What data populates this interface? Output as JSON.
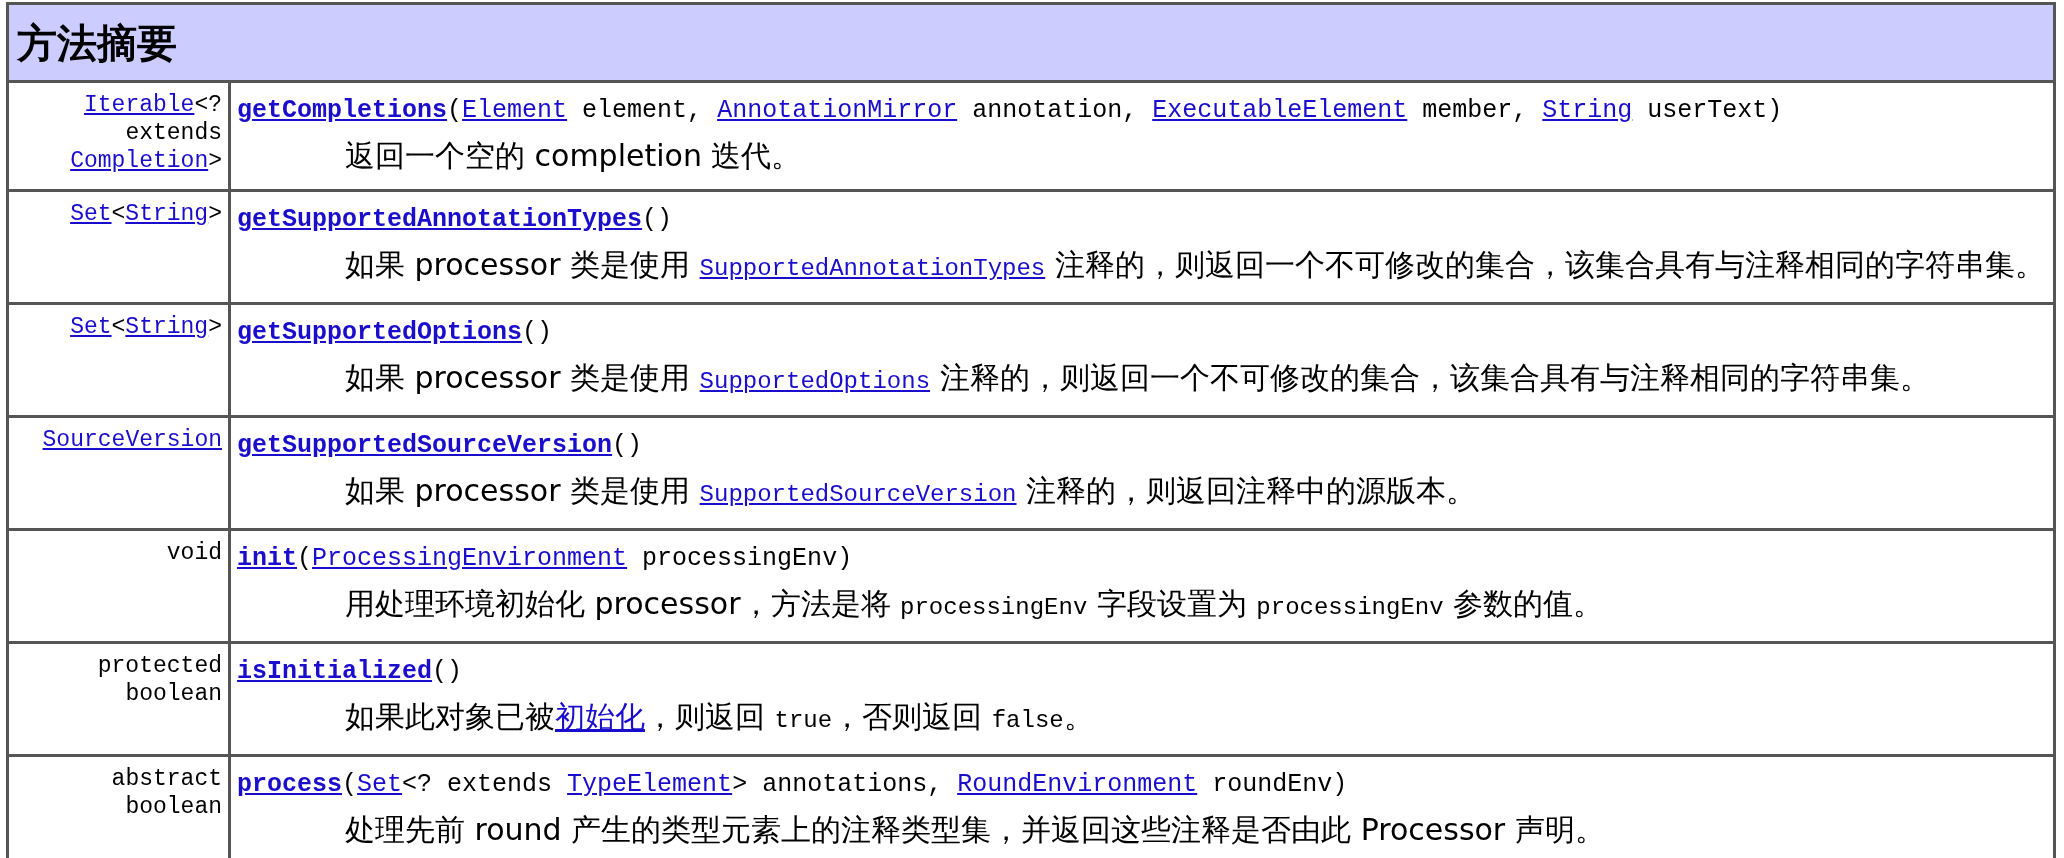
{
  "title": "方法摘要",
  "rows": [
    {
      "type": [
        {
          "kind": "link",
          "text": "Iterable"
        },
        {
          "kind": "text",
          "text": "<? extends "
        },
        {
          "kind": "link",
          "text": "Completion"
        },
        {
          "kind": "text",
          "text": ">"
        }
      ],
      "signature": [
        {
          "kind": "method",
          "text": "getCompletions"
        },
        {
          "kind": "text",
          "text": "("
        },
        {
          "kind": "link",
          "text": "Element"
        },
        {
          "kind": "text",
          "text": " element, "
        },
        {
          "kind": "link",
          "text": "AnnotationMirror"
        },
        {
          "kind": "text",
          "text": " annotation, "
        },
        {
          "kind": "link",
          "text": "ExecutableElement"
        },
        {
          "kind": "text",
          "text": " member, "
        },
        {
          "kind": "link",
          "text": "String"
        },
        {
          "kind": "text",
          "text": " userText)"
        }
      ],
      "description": [
        {
          "kind": "text",
          "text": "返回一个空的 completion 迭代。"
        }
      ]
    },
    {
      "type": [
        {
          "kind": "link",
          "text": "Set"
        },
        {
          "kind": "text",
          "text": "<"
        },
        {
          "kind": "link",
          "text": "String"
        },
        {
          "kind": "text",
          "text": ">"
        }
      ],
      "signature": [
        {
          "kind": "method",
          "text": "getSupportedAnnotationTypes"
        },
        {
          "kind": "text",
          "text": "()"
        }
      ],
      "description": [
        {
          "kind": "text",
          "text": "如果 processor 类是使用 "
        },
        {
          "kind": "link",
          "text": "SupportedAnnotationTypes"
        },
        {
          "kind": "text",
          "text": " 注释的，则返回一个不可修改的集合，该集合具有与注释相同的字符串集。"
        }
      ]
    },
    {
      "type": [
        {
          "kind": "link",
          "text": "Set"
        },
        {
          "kind": "text",
          "text": "<"
        },
        {
          "kind": "link",
          "text": "String"
        },
        {
          "kind": "text",
          "text": ">"
        }
      ],
      "signature": [
        {
          "kind": "method",
          "text": "getSupportedOptions"
        },
        {
          "kind": "text",
          "text": "()"
        }
      ],
      "description": [
        {
          "kind": "text",
          "text": "如果 processor 类是使用 "
        },
        {
          "kind": "link",
          "text": "SupportedOptions"
        },
        {
          "kind": "text",
          "text": " 注释的，则返回一个不可修改的集合，该集合具有与注释相同的字符串集。"
        }
      ]
    },
    {
      "type": [
        {
          "kind": "link",
          "text": "SourceVersion"
        }
      ],
      "signature": [
        {
          "kind": "method",
          "text": "getSupportedSourceVersion"
        },
        {
          "kind": "text",
          "text": "()"
        }
      ],
      "description": [
        {
          "kind": "text",
          "text": "如果 processor 类是使用 "
        },
        {
          "kind": "link",
          "text": "SupportedSourceVersion"
        },
        {
          "kind": "text",
          "text": " 注释的，则返回注释中的源版本。"
        }
      ]
    },
    {
      "type": [
        {
          "kind": "text",
          "text": "void"
        }
      ],
      "signature": [
        {
          "kind": "method",
          "text": "init"
        },
        {
          "kind": "text",
          "text": "("
        },
        {
          "kind": "link",
          "text": "ProcessingEnvironment"
        },
        {
          "kind": "text",
          "text": " processingEnv)"
        }
      ],
      "description": [
        {
          "kind": "text",
          "text": "用处理环境初始化 processor，方法是将 "
        },
        {
          "kind": "code",
          "text": "processingEnv"
        },
        {
          "kind": "text",
          "text": " 字段设置为 "
        },
        {
          "kind": "code",
          "text": "processingEnv"
        },
        {
          "kind": "text",
          "text": " 参数的值。"
        }
      ]
    },
    {
      "type": [
        {
          "kind": "text",
          "text": "protected boolean"
        }
      ],
      "signature": [
        {
          "kind": "method",
          "text": "isInitialized"
        },
        {
          "kind": "text",
          "text": "()"
        }
      ],
      "description": [
        {
          "kind": "text",
          "text": "如果此对象已被"
        },
        {
          "kind": "textlink",
          "text": "初始化"
        },
        {
          "kind": "text",
          "text": "，则返回 "
        },
        {
          "kind": "code",
          "text": "true"
        },
        {
          "kind": "text",
          "text": "，否则返回 "
        },
        {
          "kind": "code",
          "text": "false"
        },
        {
          "kind": "text",
          "text": "。"
        }
      ]
    },
    {
      "type": [
        {
          "kind": "text",
          "text": "abstract boolean"
        }
      ],
      "signature": [
        {
          "kind": "method",
          "text": "process"
        },
        {
          "kind": "text",
          "text": "("
        },
        {
          "kind": "link",
          "text": "Set"
        },
        {
          "kind": "text",
          "text": "<? extends "
        },
        {
          "kind": "link",
          "text": "TypeElement"
        },
        {
          "kind": "text",
          "text": "> annotations, "
        },
        {
          "kind": "link",
          "text": "RoundEnvironment"
        },
        {
          "kind": "text",
          "text": " roundEnv)"
        }
      ],
      "description": [
        {
          "kind": "text",
          "text": "处理先前 round 产生的类型元素上的注释类型集，并返回这些注释是否由此 Processor 声明。"
        }
      ]
    }
  ]
}
